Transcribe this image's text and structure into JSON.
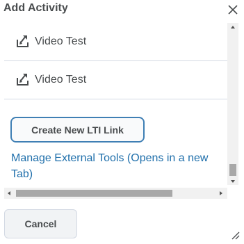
{
  "dialog": {
    "title": "Add Activity",
    "close_icon": "close-icon"
  },
  "items": [
    {
      "label": "Video Test",
      "icon": "lti-link-icon"
    },
    {
      "label": "Video Test",
      "icon": "lti-link-icon"
    }
  ],
  "actions": {
    "create_lti_label": "Create New LTI Link",
    "manage_tools_label": "Manage External Tools (Opens in a new Tab)"
  },
  "footer": {
    "cancel_label": "Cancel"
  },
  "colors": {
    "accent": "#3f7fb4",
    "link": "#1f6fab",
    "text": "#494c4e",
    "divider": "#d3d9e3"
  }
}
